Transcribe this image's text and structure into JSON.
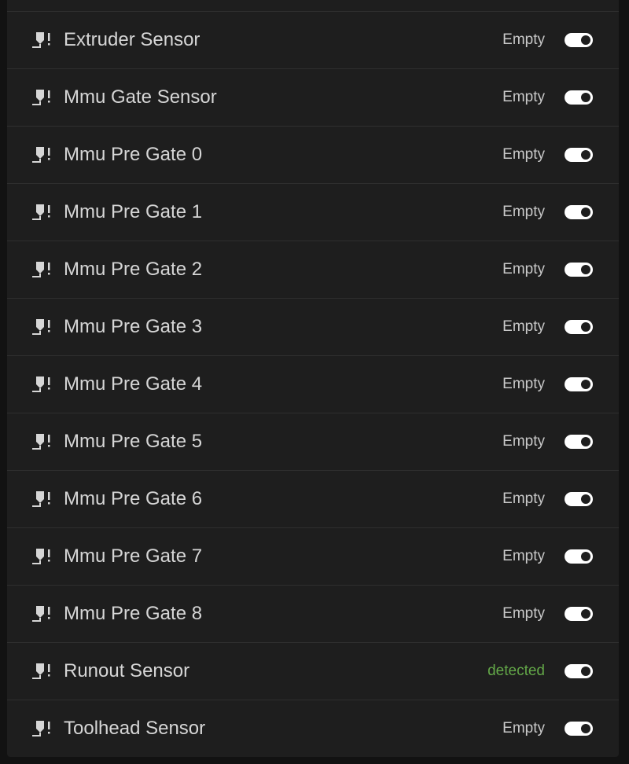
{
  "sensors": [
    {
      "name": "Extruder Sensor",
      "status": "Empty",
      "detected": false,
      "enabled": true
    },
    {
      "name": "Mmu Gate Sensor",
      "status": "Empty",
      "detected": false,
      "enabled": true
    },
    {
      "name": "Mmu Pre Gate 0",
      "status": "Empty",
      "detected": false,
      "enabled": true
    },
    {
      "name": "Mmu Pre Gate 1",
      "status": "Empty",
      "detected": false,
      "enabled": true
    },
    {
      "name": "Mmu Pre Gate 2",
      "status": "Empty",
      "detected": false,
      "enabled": true
    },
    {
      "name": "Mmu Pre Gate 3",
      "status": "Empty",
      "detected": false,
      "enabled": true
    },
    {
      "name": "Mmu Pre Gate 4",
      "status": "Empty",
      "detected": false,
      "enabled": true
    },
    {
      "name": "Mmu Pre Gate 5",
      "status": "Empty",
      "detected": false,
      "enabled": true
    },
    {
      "name": "Mmu Pre Gate 6",
      "status": "Empty",
      "detected": false,
      "enabled": true
    },
    {
      "name": "Mmu Pre Gate 7",
      "status": "Empty",
      "detected": false,
      "enabled": true
    },
    {
      "name": "Mmu Pre Gate 8",
      "status": "Empty",
      "detected": false,
      "enabled": true
    },
    {
      "name": "Runout Sensor",
      "status": "detected",
      "detected": true,
      "enabled": true
    },
    {
      "name": "Toolhead Sensor",
      "status": "Empty",
      "detected": false,
      "enabled": true
    }
  ],
  "icon": "filament-sensor-alert-icon",
  "colors": {
    "detected": "#63a748",
    "empty": "#c8c8c8",
    "toggle_on": "#ffffff"
  }
}
